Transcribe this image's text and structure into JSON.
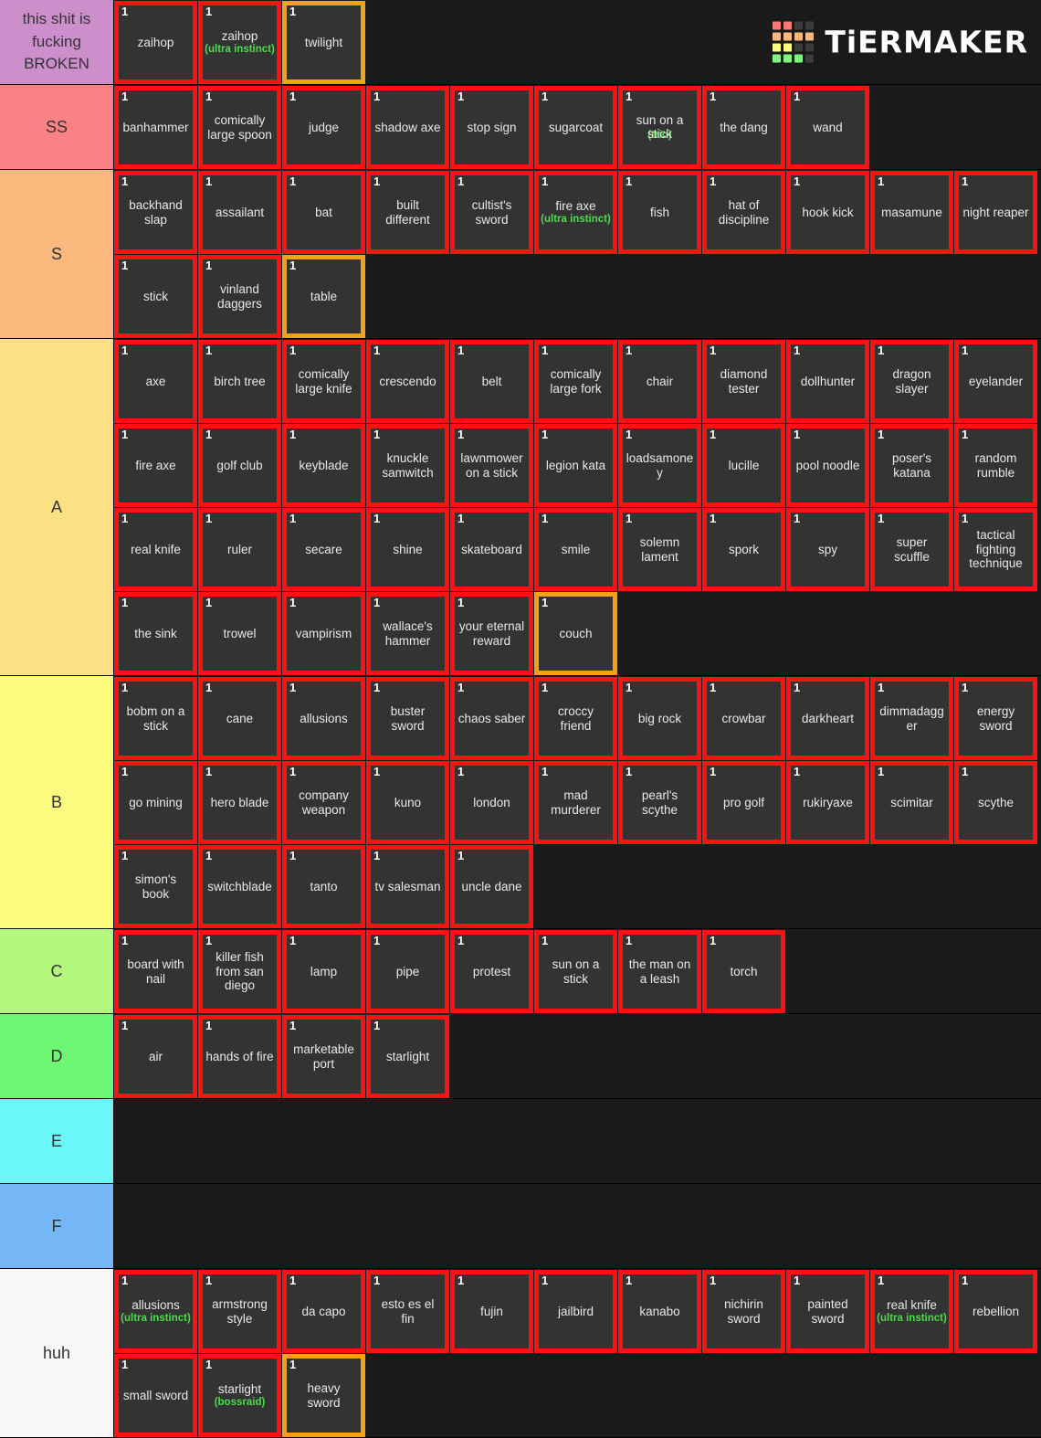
{
  "logo": {
    "name": "TiERMAKER",
    "grid_colors": [
      [
        "#ff7878",
        "#ff7878",
        "#3c3c3c",
        "#3c3c3c"
      ],
      [
        "#fcb97d",
        "#fcb97d",
        "#fcb97d",
        "#fcb97d"
      ],
      [
        "#fdfd80",
        "#fdfd80",
        "#3c3c3c",
        "#3c3c3c"
      ],
      [
        "#7ef77e",
        "#7ef77e",
        "#7ef77e",
        "#3c3c3c"
      ]
    ]
  },
  "colors": {
    "tile_border_red": "#ff1111",
    "tile_border_orange": "#f5a117",
    "tile_bg": "#333333",
    "subtitle_green": "#4ddb4d",
    "page_bg": "#1a1a1a"
  },
  "tiers": [
    {
      "label": "this shit is fucking BROKEN",
      "color": "#cc8fcc",
      "items": [
        {
          "count": "1",
          "name": "zaihop",
          "sub": "",
          "border": "red"
        },
        {
          "count": "1",
          "name": "zaihop",
          "sub": "(ultra instinct)",
          "border": "red"
        },
        {
          "count": "1",
          "name": "twilight",
          "sub": "",
          "border": "orange"
        }
      ]
    },
    {
      "label": "SS",
      "color": "#fc8185",
      "items": [
        {
          "count": "1",
          "name": "banhammer",
          "sub": "",
          "border": "red"
        },
        {
          "count": "1",
          "name": "comically large spoon",
          "sub": "",
          "border": "red"
        },
        {
          "count": "1",
          "name": "judge",
          "sub": "",
          "border": "red"
        },
        {
          "count": "1",
          "name": "shadow axe",
          "sub": "",
          "border": "red"
        },
        {
          "count": "1",
          "name": "stop sign",
          "sub": "",
          "border": "red"
        },
        {
          "count": "1",
          "name": "sugarcoat",
          "sub": "",
          "border": "red"
        },
        {
          "count": "1",
          "name": "sun on a stick",
          "sub": "(trio)",
          "border": "red",
          "overlap": true
        },
        {
          "count": "1",
          "name": "the dang",
          "sub": "",
          "border": "red"
        },
        {
          "count": "1",
          "name": "wand",
          "sub": "",
          "border": "red"
        }
      ]
    },
    {
      "label": "S",
      "color": "#fcb97d",
      "items": [
        {
          "count": "1",
          "name": "backhand slap",
          "sub": "",
          "border": "red"
        },
        {
          "count": "1",
          "name": "assailant",
          "sub": "",
          "border": "red"
        },
        {
          "count": "1",
          "name": "bat",
          "sub": "",
          "border": "red"
        },
        {
          "count": "1",
          "name": "built different",
          "sub": "",
          "border": "red"
        },
        {
          "count": "1",
          "name": "cultist's sword",
          "sub": "",
          "border": "red"
        },
        {
          "count": "1",
          "name": "fire axe",
          "sub": "(ultra instinct)",
          "border": "red"
        },
        {
          "count": "1",
          "name": "fish",
          "sub": "",
          "border": "red"
        },
        {
          "count": "1",
          "name": "hat of discipline",
          "sub": "",
          "border": "red"
        },
        {
          "count": "1",
          "name": "hook kick",
          "sub": "",
          "border": "red"
        },
        {
          "count": "1",
          "name": "masamune",
          "sub": "",
          "border": "red"
        },
        {
          "count": "1",
          "name": "night reaper",
          "sub": "",
          "border": "red"
        },
        {
          "count": "1",
          "name": "stick",
          "sub": "",
          "border": "red"
        },
        {
          "count": "1",
          "name": "vinland daggers",
          "sub": "",
          "border": "red"
        },
        {
          "count": "1",
          "name": "table",
          "sub": "",
          "border": "orange"
        }
      ]
    },
    {
      "label": "A",
      "color": "#fce184",
      "items": [
        {
          "count": "1",
          "name": "axe",
          "sub": "",
          "border": "red"
        },
        {
          "count": "1",
          "name": "birch tree",
          "sub": "",
          "border": "red"
        },
        {
          "count": "1",
          "name": "comically large knife",
          "sub": "",
          "border": "red"
        },
        {
          "count": "1",
          "name": "crescendo",
          "sub": "",
          "border": "red"
        },
        {
          "count": "1",
          "name": "belt",
          "sub": "",
          "border": "red"
        },
        {
          "count": "1",
          "name": "comically large fork",
          "sub": "",
          "border": "red"
        },
        {
          "count": "1",
          "name": "chair",
          "sub": "",
          "border": "red"
        },
        {
          "count": "1",
          "name": "diamond tester",
          "sub": "",
          "border": "red"
        },
        {
          "count": "1",
          "name": "dollhunter",
          "sub": "",
          "border": "red"
        },
        {
          "count": "1",
          "name": "dragon slayer",
          "sub": "",
          "border": "red"
        },
        {
          "count": "1",
          "name": "eyelander",
          "sub": "",
          "border": "red"
        },
        {
          "count": "1",
          "name": "fire axe",
          "sub": "",
          "border": "red"
        },
        {
          "count": "1",
          "name": "golf club",
          "sub": "",
          "border": "red"
        },
        {
          "count": "1",
          "name": "keyblade",
          "sub": "",
          "border": "red"
        },
        {
          "count": "1",
          "name": "knuckle samwitch",
          "sub": "",
          "border": "red"
        },
        {
          "count": "1",
          "name": "lawnmower on a stick",
          "sub": "",
          "border": "red"
        },
        {
          "count": "1",
          "name": "legion kata",
          "sub": "",
          "border": "red"
        },
        {
          "count": "1",
          "name": "loadsamoney",
          "sub": "",
          "border": "red"
        },
        {
          "count": "1",
          "name": "lucille",
          "sub": "",
          "border": "red"
        },
        {
          "count": "1",
          "name": "pool noodle",
          "sub": "",
          "border": "red"
        },
        {
          "count": "1",
          "name": "poser's katana",
          "sub": "",
          "border": "red"
        },
        {
          "count": "1",
          "name": "random rumble",
          "sub": "",
          "border": "red"
        },
        {
          "count": "1",
          "name": "real knife",
          "sub": "",
          "border": "red"
        },
        {
          "count": "1",
          "name": "ruler",
          "sub": "",
          "border": "red"
        },
        {
          "count": "1",
          "name": "secare",
          "sub": "",
          "border": "red"
        },
        {
          "count": "1",
          "name": "shine",
          "sub": "",
          "border": "red"
        },
        {
          "count": "1",
          "name": "skateboard",
          "sub": "",
          "border": "red"
        },
        {
          "count": "1",
          "name": "smile",
          "sub": "",
          "border": "red"
        },
        {
          "count": "1",
          "name": "solemn lament",
          "sub": "",
          "border": "red"
        },
        {
          "count": "1",
          "name": "spork",
          "sub": "",
          "border": "red"
        },
        {
          "count": "1",
          "name": "spy",
          "sub": "",
          "border": "red"
        },
        {
          "count": "1",
          "name": "super scuffle",
          "sub": "",
          "border": "red"
        },
        {
          "count": "1",
          "name": "tactical fighting technique",
          "sub": "",
          "border": "red"
        },
        {
          "count": "1",
          "name": "the sink",
          "sub": "",
          "border": "red"
        },
        {
          "count": "1",
          "name": "trowel",
          "sub": "",
          "border": "red"
        },
        {
          "count": "1",
          "name": "vampirism",
          "sub": "",
          "border": "red"
        },
        {
          "count": "1",
          "name": "wallace's hammer",
          "sub": "",
          "border": "red"
        },
        {
          "count": "1",
          "name": "your eternal reward",
          "sub": "",
          "border": "red"
        },
        {
          "count": "1",
          "name": "couch",
          "sub": "",
          "border": "orange"
        }
      ]
    },
    {
      "label": "B",
      "color": "#fbfb80",
      "items": [
        {
          "count": "1",
          "name": "bobm on a stick",
          "sub": "",
          "border": "red"
        },
        {
          "count": "1",
          "name": "cane",
          "sub": "",
          "border": "red"
        },
        {
          "count": "1",
          "name": "allusions",
          "sub": "",
          "border": "red"
        },
        {
          "count": "1",
          "name": "buster sword",
          "sub": "",
          "border": "red"
        },
        {
          "count": "1",
          "name": "chaos saber",
          "sub": "",
          "border": "red"
        },
        {
          "count": "1",
          "name": "croccy friend",
          "sub": "",
          "border": "red"
        },
        {
          "count": "1",
          "name": "big rock",
          "sub": "",
          "border": "red"
        },
        {
          "count": "1",
          "name": "crowbar",
          "sub": "",
          "border": "red"
        },
        {
          "count": "1",
          "name": "darkheart",
          "sub": "",
          "border": "red"
        },
        {
          "count": "1",
          "name": "dimmadagger",
          "sub": "",
          "border": "red"
        },
        {
          "count": "1",
          "name": "energy sword",
          "sub": "",
          "border": "red"
        },
        {
          "count": "1",
          "name": "go mining",
          "sub": "",
          "border": "red"
        },
        {
          "count": "1",
          "name": "hero blade",
          "sub": "",
          "border": "red"
        },
        {
          "count": "1",
          "name": "company weapon",
          "sub": "",
          "border": "red"
        },
        {
          "count": "1",
          "name": "kuno",
          "sub": "",
          "border": "red"
        },
        {
          "count": "1",
          "name": "london",
          "sub": "",
          "border": "red"
        },
        {
          "count": "1",
          "name": "mad murderer",
          "sub": "",
          "border": "red"
        },
        {
          "count": "1",
          "name": "pearl's scythe",
          "sub": "",
          "border": "red"
        },
        {
          "count": "1",
          "name": "pro golf",
          "sub": "",
          "border": "red"
        },
        {
          "count": "1",
          "name": "rukiryaxe",
          "sub": "",
          "border": "red"
        },
        {
          "count": "1",
          "name": "scimitar",
          "sub": "",
          "border": "red"
        },
        {
          "count": "1",
          "name": "scythe",
          "sub": "",
          "border": "red"
        },
        {
          "count": "1",
          "name": "simon's book",
          "sub": "",
          "border": "red"
        },
        {
          "count": "1",
          "name": "switchblade",
          "sub": "",
          "border": "red"
        },
        {
          "count": "1",
          "name": "tanto",
          "sub": "",
          "border": "red"
        },
        {
          "count": "1",
          "name": "tv salesman",
          "sub": "",
          "border": "red"
        },
        {
          "count": "1",
          "name": "uncle dane",
          "sub": "",
          "border": "red"
        }
      ]
    },
    {
      "label": "C",
      "color": "#b4f97c",
      "items": [
        {
          "count": "1",
          "name": "board with nail",
          "sub": "",
          "border": "red"
        },
        {
          "count": "1",
          "name": "killer fish from san diego",
          "sub": "",
          "border": "red"
        },
        {
          "count": "1",
          "name": "lamp",
          "sub": "",
          "border": "red"
        },
        {
          "count": "1",
          "name": "pipe",
          "sub": "",
          "border": "red"
        },
        {
          "count": "1",
          "name": "protest",
          "sub": "",
          "border": "red"
        },
        {
          "count": "1",
          "name": "sun on a stick",
          "sub": "",
          "border": "red"
        },
        {
          "count": "1",
          "name": "the man on a leash",
          "sub": "",
          "border": "red"
        },
        {
          "count": "1",
          "name": "torch",
          "sub": "",
          "border": "red"
        }
      ]
    },
    {
      "label": "D",
      "color": "#6ef774",
      "items": [
        {
          "count": "1",
          "name": "air",
          "sub": "",
          "border": "red"
        },
        {
          "count": "1",
          "name": "hands of fire",
          "sub": "",
          "border": "red"
        },
        {
          "count": "1",
          "name": "marketable port",
          "sub": "",
          "border": "red"
        },
        {
          "count": "1",
          "name": "starlight",
          "sub": "",
          "border": "red"
        }
      ]
    },
    {
      "label": "E",
      "color": "#6bf7f7",
      "items": []
    },
    {
      "label": "F",
      "color": "#75b6f7",
      "items": []
    },
    {
      "label": "huh",
      "color": "#f7f7f7",
      "items": [
        {
          "count": "1",
          "name": "allusions",
          "sub": "(ultra instinct)",
          "border": "red"
        },
        {
          "count": "1",
          "name": "armstrong style",
          "sub": "",
          "border": "red"
        },
        {
          "count": "1",
          "name": "da capo",
          "sub": "",
          "border": "red"
        },
        {
          "count": "1",
          "name": "esto es el fin",
          "sub": "",
          "border": "red"
        },
        {
          "count": "1",
          "name": "fujin",
          "sub": "",
          "border": "red"
        },
        {
          "count": "1",
          "name": "jailbird",
          "sub": "",
          "border": "red"
        },
        {
          "count": "1",
          "name": "kanabo",
          "sub": "",
          "border": "red"
        },
        {
          "count": "1",
          "name": "nichirin sword",
          "sub": "",
          "border": "red"
        },
        {
          "count": "1",
          "name": "painted sword",
          "sub": "",
          "border": "red"
        },
        {
          "count": "1",
          "name": "real knife",
          "sub": "(ultra instinct)",
          "border": "red"
        },
        {
          "count": "1",
          "name": "rebellion",
          "sub": "",
          "border": "red"
        },
        {
          "count": "1",
          "name": "small sword",
          "sub": "",
          "border": "red"
        },
        {
          "count": "1",
          "name": "starlight",
          "sub": "(bossraid)",
          "border": "red"
        },
        {
          "count": "1",
          "name": "heavy sword",
          "sub": "",
          "border": "orange"
        }
      ]
    }
  ]
}
